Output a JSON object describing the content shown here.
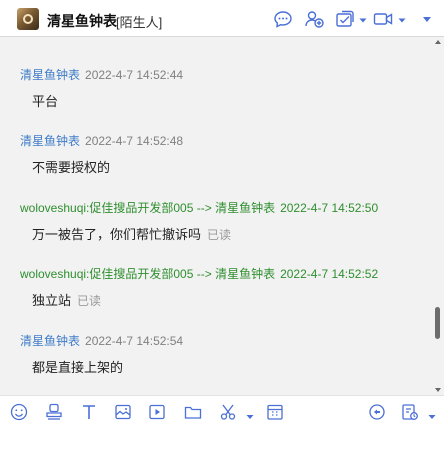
{
  "header": {
    "contact_name": "清星鱼钟表",
    "contact_tag": "[陌生人]",
    "icons": [
      "avatar",
      "chat-bubble-icon",
      "add-contact-icon",
      "task-icon",
      "video-call-icon"
    ],
    "accent_color": "#4a6fd6"
  },
  "messages": [
    {
      "sender": "清星鱼钟表",
      "time": "2022-4-7 14:52:44",
      "text": "平台",
      "read": "",
      "outgoing": false
    },
    {
      "sender": "清星鱼钟表",
      "time": "2022-4-7 14:52:48",
      "text": "不需要授权的",
      "read": "",
      "outgoing": false
    },
    {
      "sender": "woloveshuqi:促佳搜品开发部005 --> 清星鱼钟表",
      "time": "2022-4-7 14:52:50",
      "text": "万一被告了，你们帮忙撤诉吗",
      "read": "已读",
      "outgoing": true
    },
    {
      "sender": "woloveshuqi:促佳搜品开发部005 --> 清星鱼钟表",
      "time": "2022-4-7 14:52:52",
      "text": "独立站",
      "read": "已读",
      "outgoing": true
    },
    {
      "sender": "清星鱼钟表",
      "time": "2022-4-7 14:52:54",
      "text": "都是直接上架的",
      "read": "",
      "outgoing": false
    }
  ],
  "colors": {
    "incoming_sender": "#3e7cc8",
    "outgoing_sender": "#2f8f2f",
    "chat_background": "#f2f2f2"
  },
  "toolbar": {
    "icons": [
      "emoji-icon",
      "stamp-icon",
      "font-icon",
      "image-icon",
      "video-icon",
      "folder-icon",
      "scissors-icon",
      "calendar-icon",
      "quick-reply-icon",
      "history-icon"
    ]
  },
  "input": {
    "value": ""
  }
}
